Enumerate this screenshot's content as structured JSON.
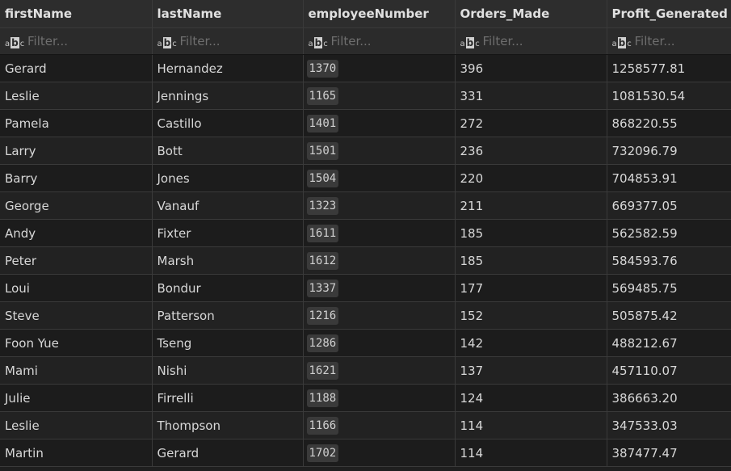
{
  "columns": [
    {
      "label": "firstName",
      "filter_placeholder": "Filter..."
    },
    {
      "label": "lastName",
      "filter_placeholder": "Filter..."
    },
    {
      "label": "employeeNumber",
      "filter_placeholder": "Filter..."
    },
    {
      "label": "Orders_Made",
      "filter_placeholder": "Filter..."
    },
    {
      "label": "Profit_Generated",
      "filter_placeholder": "Filter..."
    }
  ],
  "filter_icon": "abc-text-icon",
  "rows": [
    [
      "Gerard",
      "Hernandez",
      "1370",
      "396",
      "1258577.81"
    ],
    [
      "Leslie",
      "Jennings",
      "1165",
      "331",
      "1081530.54"
    ],
    [
      "Pamela",
      "Castillo",
      "1401",
      "272",
      "868220.55"
    ],
    [
      "Larry",
      "Bott",
      "1501",
      "236",
      "732096.79"
    ],
    [
      "Barry",
      "Jones",
      "1504",
      "220",
      "704853.91"
    ],
    [
      "George",
      "Vanauf",
      "1323",
      "211",
      "669377.05"
    ],
    [
      "Andy",
      "Fixter",
      "1611",
      "185",
      "562582.59"
    ],
    [
      "Peter",
      "Marsh",
      "1612",
      "185",
      "584593.76"
    ],
    [
      "Loui",
      "Bondur",
      "1337",
      "177",
      "569485.75"
    ],
    [
      "Steve",
      "Patterson",
      "1216",
      "152",
      "505875.42"
    ],
    [
      "Foon Yue",
      "Tseng",
      "1286",
      "142",
      "488212.67"
    ],
    [
      "Mami",
      "Nishi",
      "1621",
      "137",
      "457110.07"
    ],
    [
      "Julie",
      "Firrelli",
      "1188",
      "124",
      "386663.20"
    ],
    [
      "Leslie",
      "Thompson",
      "1166",
      "114",
      "347533.03"
    ],
    [
      "Martin",
      "Gerard",
      "1702",
      "114",
      "387477.47"
    ]
  ]
}
